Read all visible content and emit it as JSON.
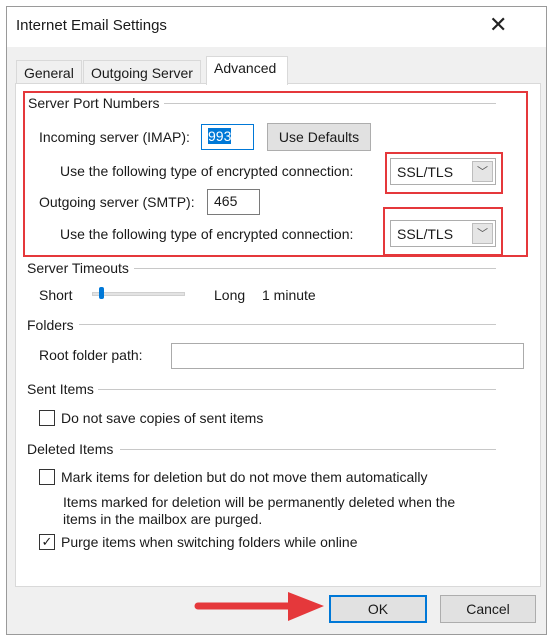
{
  "window": {
    "title": "Internet Email Settings",
    "close_icon": "close-icon"
  },
  "tabs": [
    {
      "label": "General"
    },
    {
      "label": "Outgoing Server"
    },
    {
      "label": "Advanced",
      "selected": true
    }
  ],
  "server_ports": {
    "heading": "Server Port Numbers",
    "incoming_label": "Incoming server (IMAP):",
    "incoming_value": "993",
    "use_defaults": "Use Defaults",
    "enc_label": "Use the following type of encrypted connection:",
    "incoming_enc": "SSL/TLS",
    "outgoing_label": "Outgoing server (SMTP):",
    "outgoing_value": "465",
    "outgoing_enc": "SSL/TLS"
  },
  "timeouts": {
    "heading": "Server Timeouts",
    "short": "Short",
    "long": "Long",
    "value": "1 minute",
    "slider_fraction": 0.08
  },
  "folders": {
    "heading": "Folders",
    "root_label": "Root folder path:",
    "root_value": ""
  },
  "sent": {
    "heading": "Sent Items",
    "no_copies": "Do not save copies of sent items",
    "no_copies_checked": false
  },
  "deleted": {
    "heading": "Deleted Items",
    "mark": "Mark items for deletion but do not move them automatically",
    "mark_checked": false,
    "note_line1": "Items marked for deletion will be permanently deleted when the",
    "note_line2": "items in the mailbox are purged.",
    "purge": "Purge items when switching folders while online",
    "purge_checked": true
  },
  "footer": {
    "ok": "OK",
    "cancel": "Cancel"
  },
  "colors": {
    "highlight": "#e5383b",
    "accent": "#0078d7"
  }
}
